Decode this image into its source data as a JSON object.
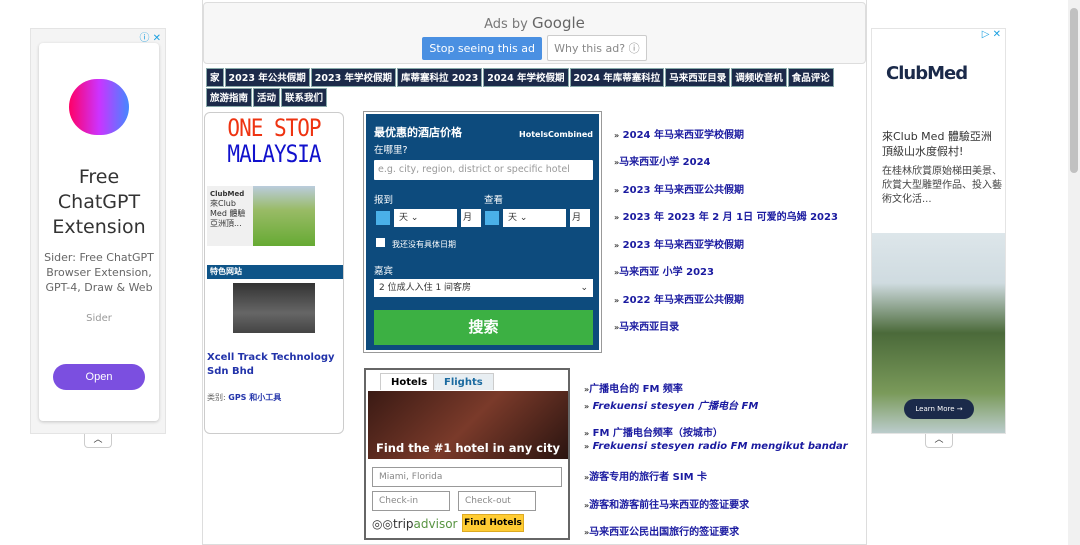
{
  "left_ad": {
    "headline": "Free ChatGPT Extension",
    "description": "Sider: Free ChatGPT Browser Extension, GPT-4, Draw & Web",
    "advertiser": "Sider",
    "cta": "Open"
  },
  "top_ad": {
    "ads_by": "Ads by",
    "google": "Google",
    "stop": "Stop seeing this ad",
    "why": "Why this ad? ⓘ"
  },
  "nav": [
    "家",
    "2023 年公共假期",
    "2023 年学校假期",
    "库蒂塞科拉 2023",
    "2024 年学校假期",
    "2024 年库蒂塞科拉",
    "马来西亚目录",
    "调频收音机",
    "食品评论",
    "旅游指南",
    "活动",
    "联系我们"
  ],
  "left_col": {
    "logo_line1": "ONE STOP",
    "logo_line2": "MALAYSIA",
    "mini_ad_brand": "ClubMed",
    "mini_ad_text": "來Club Med 體驗亞洲頂...",
    "featured_label": "特色网站",
    "site_name": "Xcell Track Technology Sdn Bhd",
    "category_label": "类别:",
    "category": "GPS 和小工具"
  },
  "hotels_combined": {
    "title": "最优惠的酒店价格",
    "powered": "HotelsCombined",
    "where_label": "在哪里?",
    "where_placeholder": "e.g. city, region, district or specific hotel",
    "checkin_label": "报到",
    "checkout_label": "查看",
    "day": "天",
    "month": "月",
    "no_dates": "我还没有具体日期",
    "guests_label": "嘉宾",
    "guests_value": "2 位成人入住 1 间客房",
    "search": "搜索"
  },
  "links_top": [
    "2024 年马来西亚学校假期",
    "马来西亚小学 2024",
    "2023 年马来西亚公共假期",
    "2023 年 2023 年 2 月 1日 可爱的乌姆 2023",
    "2023 年马来西亚学校假期",
    "马来西亚 小学 2023",
    "2022 年马来西亚公共假期",
    "马来西亚目录"
  ],
  "tripadvisor": {
    "tab_hotels": "Hotels",
    "tab_flights": "Flights",
    "banner": "Find the #1 hotel in any city",
    "location": "Miami, Florida",
    "checkin": "Check-in",
    "checkout": "Check-out",
    "logo_trip": "trip",
    "logo_advisor": "advisor",
    "find": "Find Hotels"
  },
  "links_bottom": [
    "广播电台的 FM 频率",
    "Frekuensi stesyen 广播电台 FM",
    "FM 广播电台频率（按城市）",
    "Frekuensi stesyen radio FM mengikut bandar",
    "游客专用的旅行者 SIM 卡",
    "游客和游客前往马来西亚的签证要求",
    "马来西亚公民出国旅行的签证要求"
  ],
  "right_ad": {
    "brand": "ClubMed",
    "title": "來Club Med 體驗亞洲頂級山水度假村!",
    "text": "在桂林欣賞原始梯田美景、欣賞大型雕塑作品、投入藝術文化活...",
    "cta": "Learn More →"
  }
}
